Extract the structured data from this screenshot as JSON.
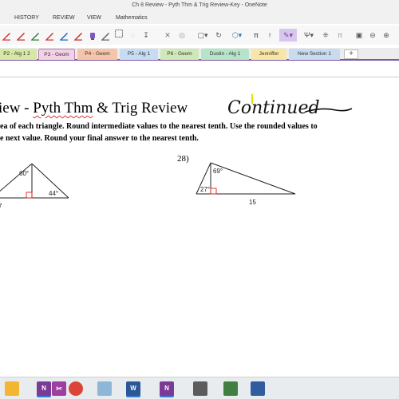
{
  "window": {
    "title": "Ch 8 Review - Pyth Thm & Trig Review-Key - OneNote"
  },
  "ribbon_tabs": [
    {
      "label": "HISTORY"
    },
    {
      "label": "REVIEW"
    },
    {
      "label": "VIEW"
    },
    {
      "label": "Mathematics"
    }
  ],
  "toolbar": {
    "pi_symbol": "π",
    "pen_colors": [
      "#d32f2f",
      "#c62828",
      "#2e7d32",
      "#d32f2f",
      "#1565c0",
      "#c62828",
      "#616161"
    ]
  },
  "sections": [
    {
      "label": "P2 - Alg 1 2",
      "color": "#d7e7a5"
    },
    {
      "label": "P3 - Geom",
      "color": "#f4d2e6",
      "active": true
    },
    {
      "label": "P4 - Geom",
      "color": "#f6c4a8"
    },
    {
      "label": "P5 - Alg 1",
      "color": "#c6dcf3"
    },
    {
      "label": "P6 - Geom",
      "color": "#cfe8b8"
    },
    {
      "label": "Dustin - Alg 1",
      "color": "#b5e4c8"
    },
    {
      "label": "Jenniffer",
      "color": "#f7e6a6"
    },
    {
      "label": "New Section 1",
      "color": "#c9dbef"
    }
  ],
  "add_section": "+",
  "page": {
    "title_prefix": "iew - ",
    "title_underlined": "Pyth Thm",
    "title_suffix": " & Trig Review",
    "handwritten": "Continued",
    "instruction_line1": "ea of each triangle.  Round intermediate values to the nearest tenth.  Use the rounded values to",
    "instruction_line2": "e next value.  Round your final answer to the nearest tenth."
  },
  "problem_left": {
    "angle_top": "60°",
    "angle_right": "44°",
    "side_label": "7"
  },
  "problem_right": {
    "number": "28)",
    "angle_top": "69°",
    "angle_left": "27°",
    "side_label": "15"
  },
  "taskbar": {
    "apps": [
      {
        "name": "file-explorer-icon",
        "label": "",
        "color": "#f2b632"
      },
      {
        "name": "onenote-icon",
        "label": "N",
        "color": "#7b3a96"
      },
      {
        "name": "snipping-tool-icon",
        "label": "✂",
        "color": "#9c3fa0"
      },
      {
        "name": "chrome-icon",
        "label": "",
        "color": "#db4437"
      },
      {
        "name": "notepad-icon",
        "label": "",
        "color": "#8cb7d6"
      },
      {
        "name": "word-icon",
        "label": "W",
        "color": "#2b5797"
      },
      {
        "name": "onenote-2-icon",
        "label": "N",
        "color": "#7b3a96"
      },
      {
        "name": "database-icon",
        "label": "",
        "color": "#5c5c5c"
      },
      {
        "name": "media-icon",
        "label": "",
        "color": "#3f7f3f"
      },
      {
        "name": "settings-icon",
        "label": "",
        "color": "#2f5d9e"
      }
    ]
  }
}
